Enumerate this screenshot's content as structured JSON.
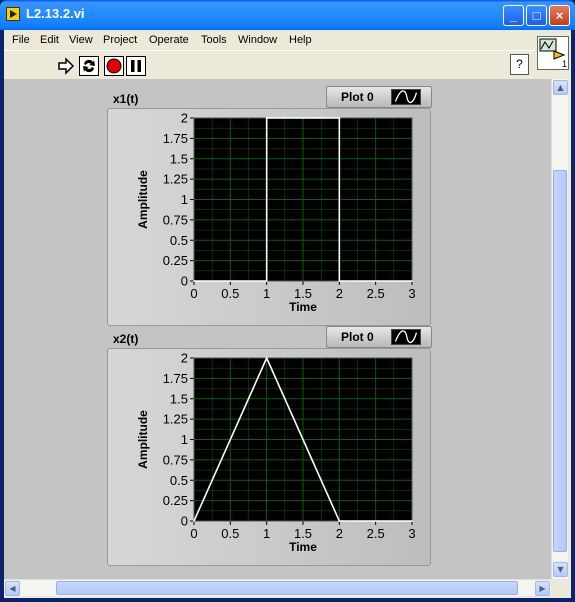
{
  "window": {
    "title": "L2.13.2.vi",
    "minimize": "_",
    "maximize": "□",
    "close": "×"
  },
  "menu": [
    "File",
    "Edit",
    "View",
    "Project",
    "Operate",
    "Tools",
    "Window",
    "Help"
  ],
  "toolbar": {
    "help_label": "?",
    "vi_icon_number": "1"
  },
  "colors": {
    "plot_bg": "#000000",
    "grid": "#0a5f0a",
    "trace": "#ffffff",
    "panel": "#c4c4c4"
  },
  "charts": [
    {
      "label": "x1(t)",
      "legend": "Plot 0",
      "xlabel": "Time",
      "ylabel": "Amplitude"
    },
    {
      "label": "x2(t)",
      "legend": "Plot 0",
      "xlabel": "Time",
      "ylabel": "Amplitude"
    }
  ],
  "chart_data": [
    {
      "type": "line",
      "title": "x1(t)",
      "xlabel": "Time",
      "ylabel": "Amplitude",
      "xlim": [
        0,
        3
      ],
      "ylim": [
        0,
        2
      ],
      "xticks": [
        "0",
        "0.5",
        "1",
        "1.5",
        "2",
        "2.5",
        "3"
      ],
      "yticks": [
        "0",
        "0.25",
        "0.5",
        "0.75",
        "1",
        "1.25",
        "1.5",
        "1.75",
        "2"
      ],
      "grid": true,
      "series": [
        {
          "name": "Plot 0",
          "x": [
            0,
            1,
            1,
            2,
            2,
            3
          ],
          "y": [
            0,
            0,
            2,
            2,
            0,
            0
          ]
        }
      ]
    },
    {
      "type": "line",
      "title": "x2(t)",
      "xlabel": "Time",
      "ylabel": "Amplitude",
      "xlim": [
        0,
        3
      ],
      "ylim": [
        0,
        2
      ],
      "xticks": [
        "0",
        "0.5",
        "1",
        "1.5",
        "2",
        "2.5",
        "3"
      ],
      "yticks": [
        "0",
        "0.25",
        "0.5",
        "0.75",
        "1",
        "1.25",
        "1.5",
        "1.75",
        "2"
      ],
      "grid": true,
      "series": [
        {
          "name": "Plot 0",
          "x": [
            0,
            1,
            2,
            3
          ],
          "y": [
            0,
            2,
            0,
            0
          ]
        }
      ]
    }
  ]
}
